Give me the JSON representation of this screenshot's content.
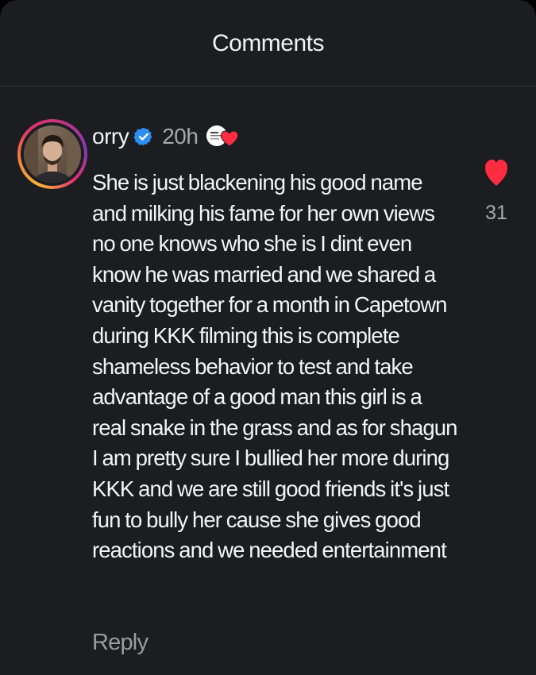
{
  "header": {
    "title": "Comments"
  },
  "comment": {
    "username": "orry",
    "verified": true,
    "timestamp": "20h",
    "liked_by_creator": true,
    "text": "She is just blackening his good name\nand milking his fame for her own views\nno one knows who she is I dint even\nknow he was married and we shared a\nvanity together for a month in Capetown\nduring KKK filming this is complete\nshameless behavior to test and take\nadvantage of a good man this girl is a\nreal snake in the grass and as for shagun\nI am pretty sure I bullied her more during\nKKK and we are still good friends it's just\nfun to bully her cause she gives good\nreactions and we needed entertainment",
    "like_count": "31",
    "reply_label": "Reply"
  },
  "icons": {
    "verified": "verified-badge-icon",
    "liked_by_creator": "creator-liked-heart-icon",
    "like": "heart-icon"
  },
  "colors": {
    "background": "#1b1d21",
    "text": "#f4f4f4",
    "muted": "#a7a8ab",
    "like_red": "#ff2d3f",
    "verified_blue": "#2d8ff0"
  }
}
